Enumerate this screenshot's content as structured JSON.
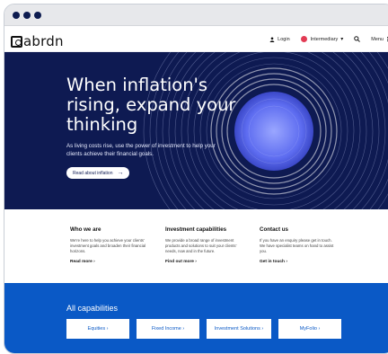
{
  "header": {
    "logo_text": "abrdn",
    "login_label": "Login",
    "audience_label": "Intermediary",
    "menu_label": "Menu"
  },
  "hero": {
    "headline": "When inflation's rising, expand your thinking",
    "subtext": "As living costs rise, use the power of investment to help your clients achieve their financial goals.",
    "cta_label": "Read about inflation",
    "cta_arrow": "→"
  },
  "info": {
    "columns": [
      {
        "title": "Who we are",
        "body": "We're here to help you achieve your clients' investment goals and broaden their financial horizons.",
        "link": "Read more ›"
      },
      {
        "title": "Investment capabilities",
        "body": "We provide a broad range of investment products and solutions to suit your clients' needs, now and in the future.",
        "link": "Find out more ›"
      },
      {
        "title": "Contact us",
        "body": "If you have an enquiry please get in touch. We have specialist teams on hand to assist you.",
        "link": "Get in touch ›"
      }
    ]
  },
  "capabilities": {
    "title": "All capabilities",
    "buttons": [
      "Equities ›",
      "Fixed Income ›",
      "Investment Solutions ›",
      "MyFolio ›"
    ]
  },
  "colors": {
    "navy": "#0e1a52",
    "blue": "#0a59c6",
    "flag": "#e23b54"
  }
}
